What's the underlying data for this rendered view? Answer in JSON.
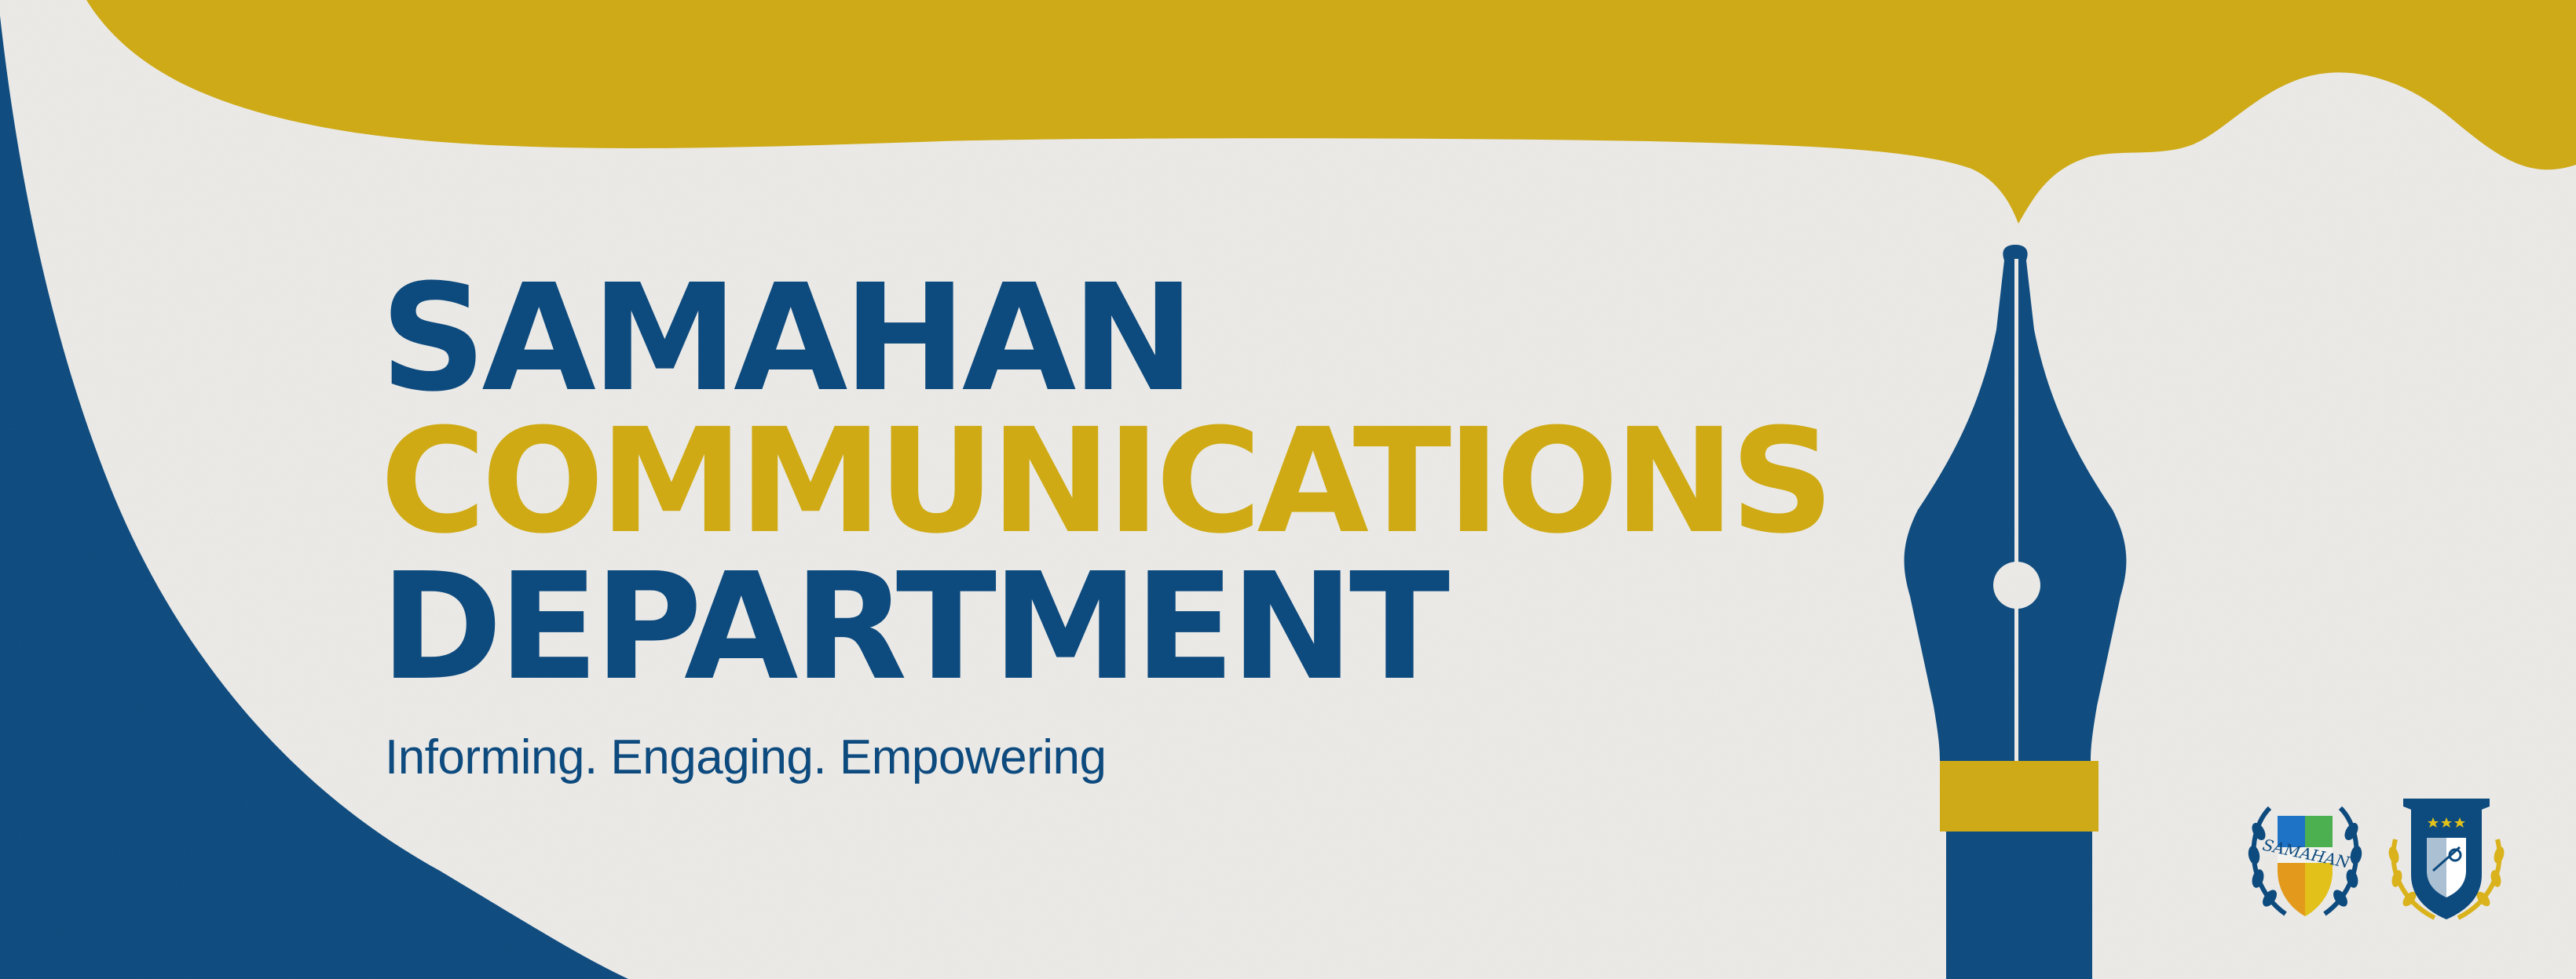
{
  "banner": {
    "title_line_1": "SAMAHAN",
    "title_line_2": "COMMUNICATIONS",
    "title_line_3": "DEPARTMENT",
    "tagline": "Informing. Engaging. Empowering",
    "logos": {
      "samahan_seal_text": "SAMAHAN"
    }
  },
  "colors": {
    "navy": "#0d4a7e",
    "gold": "#cfaa14",
    "paper": "#ebeae7"
  },
  "icons": [
    "ink-drip-shape",
    "fountain-pen-nib-icon",
    "samahan-seal-logo",
    "department-shield-logo"
  ]
}
